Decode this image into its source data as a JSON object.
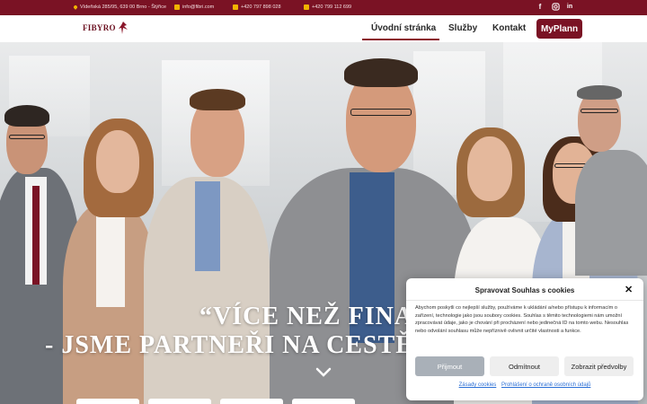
{
  "topbar": {
    "address": "Vídeňská 285/95, 639 00 Brno - Štýřice",
    "email": "info@fibri.com",
    "phone1": "+420 797 898 028",
    "phone2": "+420 799 112 699",
    "social": [
      "facebook-icon",
      "instagram-icon",
      "linkedin-icon"
    ],
    "accent_color": "#7a1224",
    "icon_color": "#f0b400"
  },
  "header": {
    "logo": "FIBYRO",
    "nav": [
      "Úvodní stránka",
      "Služby",
      "Kontakt"
    ],
    "active": "Úvodní stránka",
    "cta": "MyPlann",
    "brand_color": "#7a1224"
  },
  "hero": {
    "quote_line1": "“VÍCE NEŽ FINAN",
    "quote_line2": "- JSME PARTNEŘI NA CESTĚ",
    "scroll_icon": "chevron-down-icon"
  },
  "cookie": {
    "title": "Spravovat Souhlas s cookies",
    "text": "Abychom poskytli co nejlepší služby, používáme k ukládání a/nebo přístupu k informacím o zařízení, technologie jako jsou soubory cookies. Souhlas s těmito technologiemi nám umožní zpracovávat údaje, jako je chování při procházení nebo jedinečná ID na tomto webu. Nesouhlas nebo odvolání souhlasu může nepříznivě ovlivnit určité vlastnosti a funkce.",
    "accept": "Přijmout",
    "deny": "Odmítnout",
    "prefs": "Zobrazit předvolby",
    "link1": "Zásady cookies",
    "link2": "Prohlášení o ochraně osobních údajů",
    "close_icon": "close-icon"
  }
}
